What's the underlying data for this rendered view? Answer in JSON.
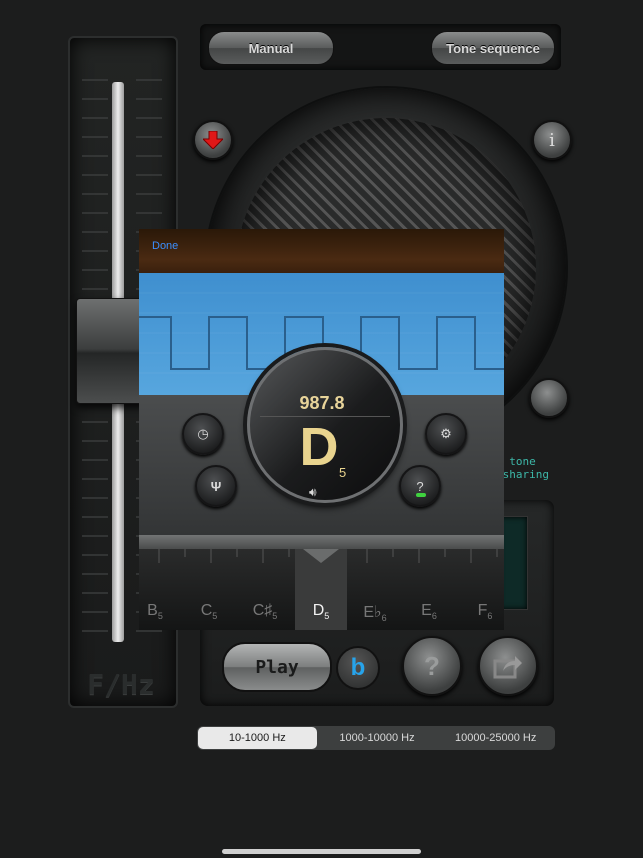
{
  "top_buttons": {
    "manual": "Manual",
    "tone_sequence": "Tone sequence"
  },
  "slider": {
    "unit_label": "F/Hz"
  },
  "speaker": {
    "sharing_text_1": "t tone",
    "sharing_text_2": " sharing"
  },
  "controls": {
    "play_label": "Play",
    "flat_symbol": "b",
    "help_symbol": "?"
  },
  "range_selector": {
    "options": [
      "10-1000 Hz",
      "1000-10000 Hz",
      "10000-25000 Hz"
    ],
    "selected": "10-1000 Hz"
  },
  "tuner": {
    "done_label": "Done",
    "frequency": "987.8",
    "note": "D",
    "octave": "5",
    "notes": [
      {
        "name": "B",
        "octave": "5"
      },
      {
        "name": "C",
        "octave": "5"
      },
      {
        "name": "C♯",
        "octave": "5"
      },
      {
        "name": "D",
        "octave": "5"
      },
      {
        "name": "E♭",
        "octave": "6"
      },
      {
        "name": "E",
        "octave": "6"
      },
      {
        "name": "F",
        "octave": "6"
      }
    ],
    "selected_note_index": 3
  },
  "colors": {
    "accent_blue": "#3b8fff",
    "note_gold": "#e9d48f",
    "wave_blue": "#4e9ed8",
    "teal_text": "#3db7a8",
    "indicator_green": "#3fd23f",
    "arrow_red": "#e01818"
  },
  "icons": {
    "down_arrow": "red-down-arrow-icon",
    "info": "info-icon",
    "speaker": "speaker-volume-icon",
    "timer": "timer-icon",
    "settings": "gear-icon",
    "tuning_fork": "tuning-fork-icon",
    "help": "question-icon",
    "share": "share-icon"
  }
}
